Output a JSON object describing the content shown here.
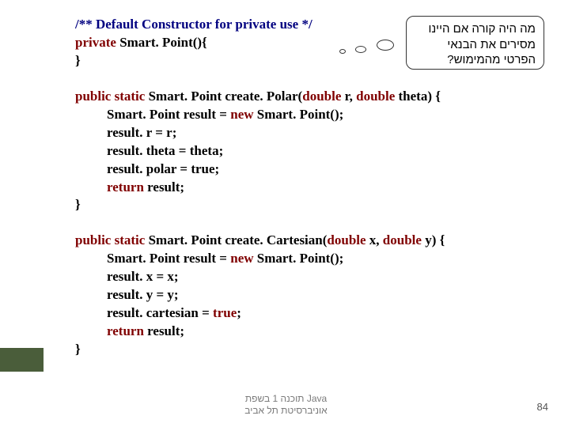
{
  "callout": {
    "line1": "מה היה קורה אם היינו",
    "line2": "מסירים את הבנאי",
    "line3": "הפרטי מהמימוש?"
  },
  "block1": {
    "comment": "/** Default Constructor for private use */",
    "kw_private": "private",
    "sig": " Smart. Point(){",
    "close": "}"
  },
  "block2": {
    "kw_public": "public",
    "kw_static": " static",
    "ret": " Smart. Point create. Polar(",
    "kw_double1": "double",
    "p1": " r, ",
    "kw_double2": "double",
    "p2": " theta) {",
    "l1a": "Smart. Point result = ",
    "kw_new": "new",
    "l1b": " Smart. Point();",
    "l2": "result. r = r;",
    "l3": "result. theta = theta;",
    "l4": "result. polar = true;",
    "kw_return": "return",
    "l5": " result;",
    "close": "}"
  },
  "block3": {
    "kw_public": "public",
    "kw_static": " static",
    "ret": " Smart. Point create. Cartesian(",
    "kw_double1": "double",
    "p1": " x, ",
    "kw_double2": "double",
    "p2": " y) {",
    "l1a": "Smart. Point result = ",
    "kw_new": "new",
    "l1b": " Smart. Point();",
    "l2": "result. x = x;",
    "l3": "result. y = y;",
    "l4a": "result. cartesian = ",
    "kw_true": "true",
    "l4b": ";",
    "kw_return": "return",
    "l5": " result;",
    "close": "}"
  },
  "footer": {
    "line1": "תוכנה 1 בשפת Java",
    "line2": "אוניברסיטת תל אביב"
  },
  "page": "84"
}
